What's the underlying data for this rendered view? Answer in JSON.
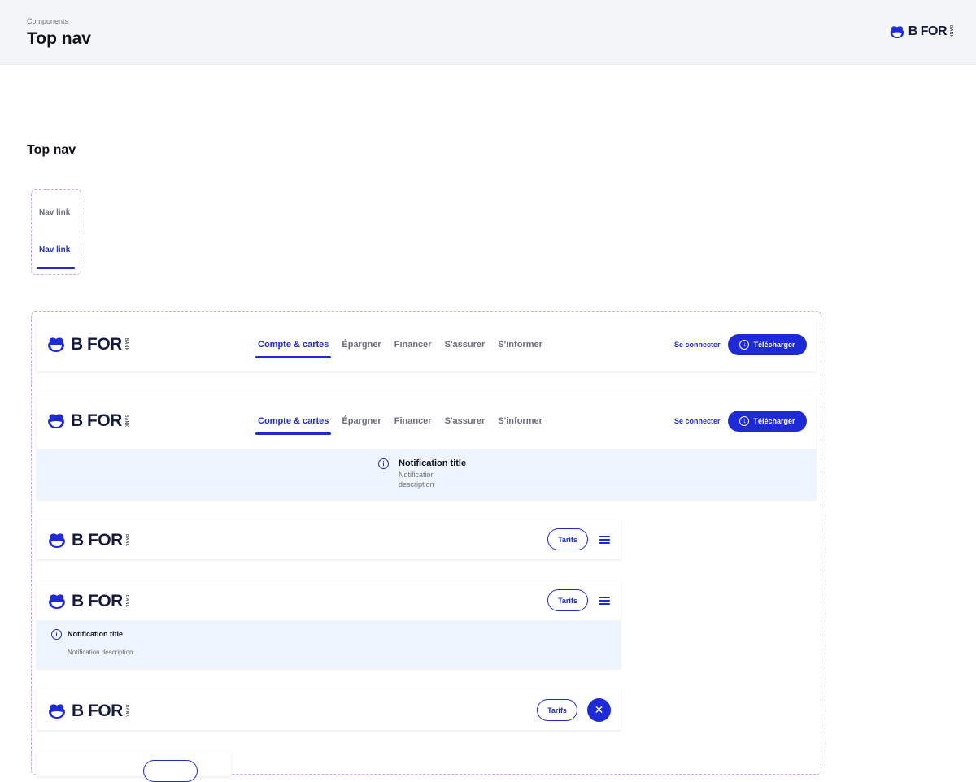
{
  "header": {
    "breadcrumb": "Components",
    "title": "Top nav",
    "brand": {
      "name": "B FOR",
      "sub": "BANK"
    }
  },
  "section": {
    "title": "Top nav"
  },
  "nav_link_states": [
    {
      "label": "Nav link",
      "state": "default"
    },
    {
      "label": "Nav link",
      "state": "active"
    }
  ],
  "brand": {
    "name": "B FOR",
    "sub": "BANK",
    "color": "#151a3d"
  },
  "colors": {
    "accent": "#1e2ad6",
    "notification_bg": "#eff5fe",
    "frame": "#c9a6f2"
  },
  "desktop_nav": {
    "menu": [
      "Compte & cartes",
      "Épargner",
      "Financer",
      "S'assurer",
      "S'informer"
    ],
    "active_index": 0,
    "login": "Se connecter",
    "download": "Télécharger",
    "download_icon": "download-circle-icon"
  },
  "desktop_notification": {
    "title": "Notification title",
    "description": "Notification description",
    "icon": "info-icon"
  },
  "mobile_nav": {
    "tarifs": "Tarifs",
    "menu_icon": "hamburger-icon",
    "close_icon": "close-icon"
  },
  "mobile_notification": {
    "title": "Notification title",
    "description": "Notification description",
    "icon": "info-icon"
  }
}
